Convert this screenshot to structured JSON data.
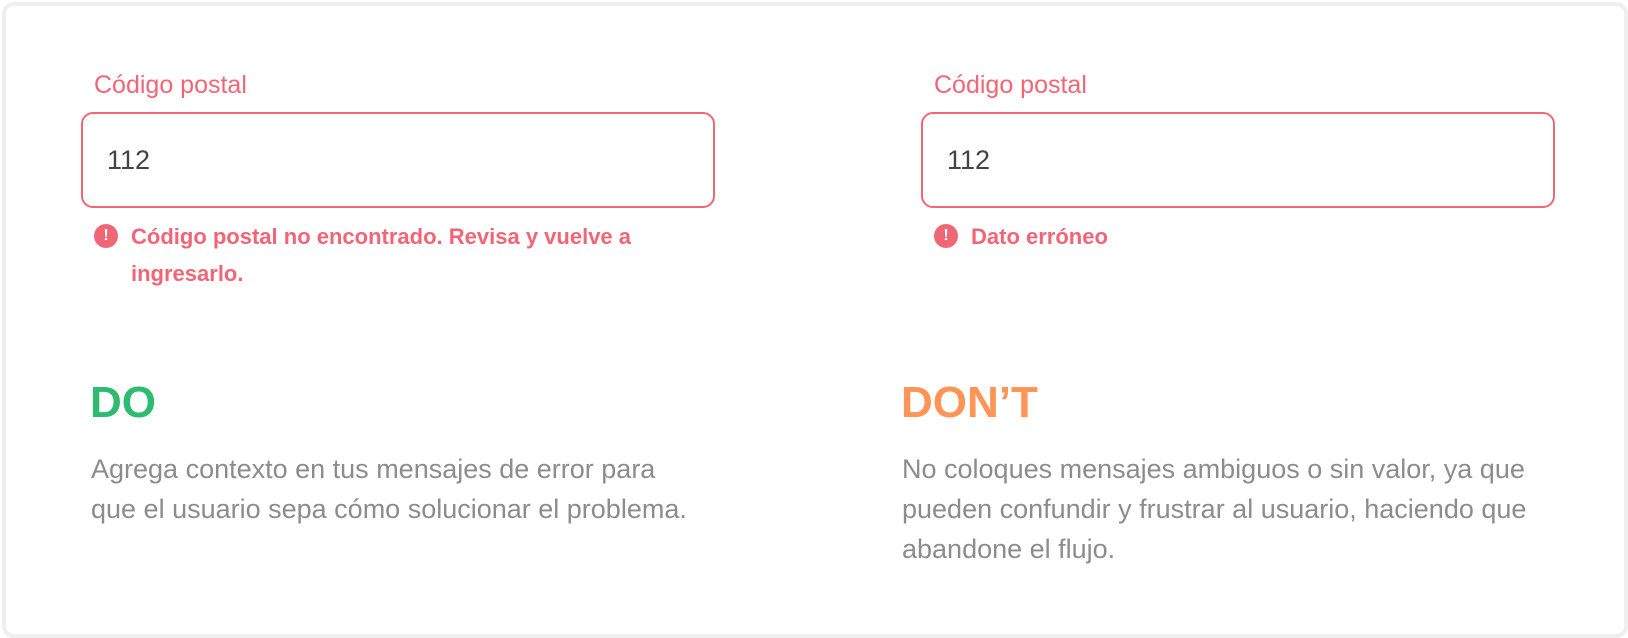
{
  "colors": {
    "error": "#f16677",
    "do": "#2dbb6f",
    "dont": "#ff9457",
    "body_text": "#8c8c8c"
  },
  "do_example": {
    "field_label": "Código postal",
    "field_value": "112",
    "error_icon": "exclamation-circle-icon",
    "error_message": "Código postal no encontrado. Revisa y vuelve a ingresarlo.",
    "heading": "DO",
    "description": "Agrega contexto en tus mensajes de error para que el usuario sepa cómo solucionar el problema."
  },
  "dont_example": {
    "field_label": "Código postal",
    "field_value": "112",
    "error_icon": "exclamation-circle-icon",
    "error_message": "Dato erróneo",
    "heading": "DON’T",
    "description": "No coloques mensajes ambiguos o sin valor, ya que pueden confundir y frustrar al usuario, haciendo que abandone el flujo."
  }
}
